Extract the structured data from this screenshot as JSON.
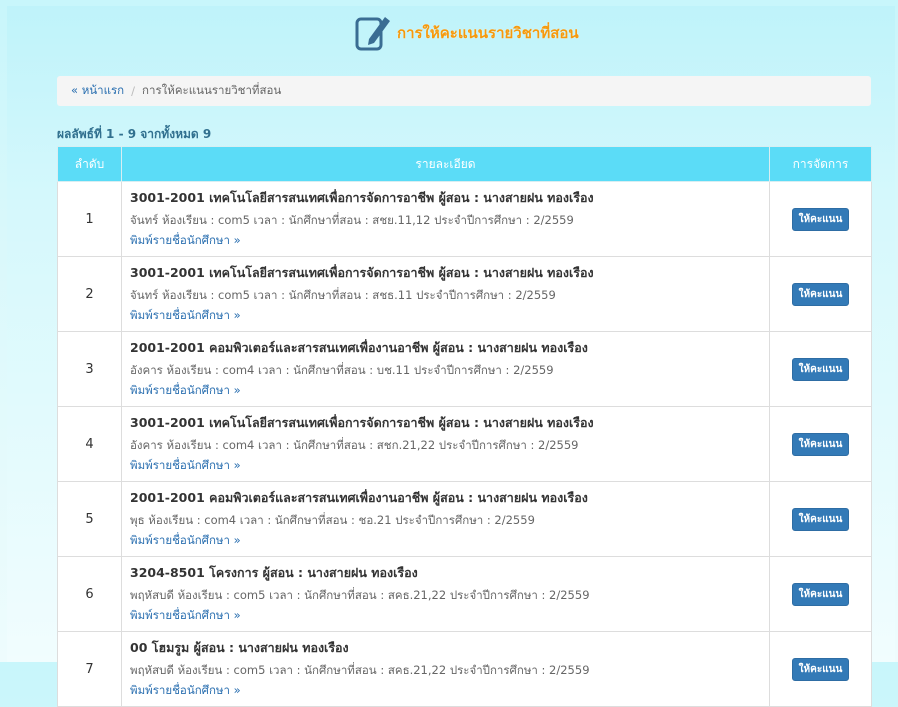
{
  "header": {
    "title": "การให้คะแนนรายวิชาที่สอน",
    "icon": "edit-document-icon"
  },
  "breadcrumb": {
    "home": "« หน้าแรก",
    "separator": "/",
    "current": "การให้คะแนนรายวิชาที่สอน"
  },
  "summary": "ผลลัพธ์ที่ 1 - 9 จากทั้งหมด 9",
  "table": {
    "headers": [
      "ลำดับ",
      "รายละเอียด",
      "การจัดการ"
    ],
    "rows": [
      {
        "num": "1",
        "course": "3001-2001 เทคโนโลยีสารสนเทศเพื่อการจัดการอาชีพ ผู้สอน : นางสายฝน ทองเรือง",
        "info": "จันทร์ ห้องเรียน : com5 เวลา : นักศึกษาที่สอน : สชย.11,12 ประจำปีการศึกษา : 2/2559",
        "print": "พิมพ์รายชื่อนักศึกษา »",
        "action": "ให้คะแนน"
      },
      {
        "num": "2",
        "course": "3001-2001 เทคโนโลยีสารสนเทศเพื่อการจัดการอาชีพ ผู้สอน : นางสายฝน ทองเรือง",
        "info": "จันทร์ ห้องเรียน : com5 เวลา : นักศึกษาที่สอน : สชธ.11 ประจำปีการศึกษา : 2/2559",
        "print": "พิมพ์รายชื่อนักศึกษา »",
        "action": "ให้คะแนน"
      },
      {
        "num": "3",
        "course": "2001-2001 คอมพิวเตอร์และสารสนเทศเพื่องานอาชีพ ผู้สอน : นางสายฝน ทองเรือง",
        "info": "อังคาร ห้องเรียน : com4 เวลา : นักศึกษาที่สอน : บช.11 ประจำปีการศึกษา : 2/2559",
        "print": "พิมพ์รายชื่อนักศึกษา »",
        "action": "ให้คะแนน"
      },
      {
        "num": "4",
        "course": "3001-2001 เทคโนโลยีสารสนเทศเพื่อการจัดการอาชีพ ผู้สอน : นางสายฝน ทองเรือง",
        "info": "อังคาร ห้องเรียน : com4 เวลา : นักศึกษาที่สอน : สชก.21,22 ประจำปีการศึกษา : 2/2559",
        "print": "พิมพ์รายชื่อนักศึกษา »",
        "action": "ให้คะแนน"
      },
      {
        "num": "5",
        "course": "2001-2001 คอมพิวเตอร์และสารสนเทศเพื่องานอาชีพ ผู้สอน : นางสายฝน ทองเรือง",
        "info": "พุธ ห้องเรียน : com4 เวลา : นักศึกษาที่สอน : ชอ.21 ประจำปีการศึกษา : 2/2559",
        "print": "พิมพ์รายชื่อนักศึกษา »",
        "action": "ให้คะแนน"
      },
      {
        "num": "6",
        "course": "3204-8501 โครงการ ผู้สอน : นางสายฝน ทองเรือง",
        "info": "พฤหัสบดี ห้องเรียน : com5 เวลา : นักศึกษาที่สอน : สคธ.21,22 ประจำปีการศึกษา : 2/2559",
        "print": "พิมพ์รายชื่อนักศึกษา »",
        "action": "ให้คะแนน"
      },
      {
        "num": "7",
        "course": "00 โฮมรูม ผู้สอน : นางสายฝน ทองเรือง",
        "info": "พฤหัสบดี ห้องเรียน : com5 เวลา : นักศึกษาที่สอน : สคธ.21,22 ประจำปีการศึกษา : 2/2559",
        "print": "พิมพ์รายชื่อนักศึกษา »",
        "action": "ให้คะแนน"
      }
    ]
  },
  "colors": {
    "header_bg": "#5bdcf7",
    "button": "#337ab7",
    "title": "#f59a0d"
  }
}
